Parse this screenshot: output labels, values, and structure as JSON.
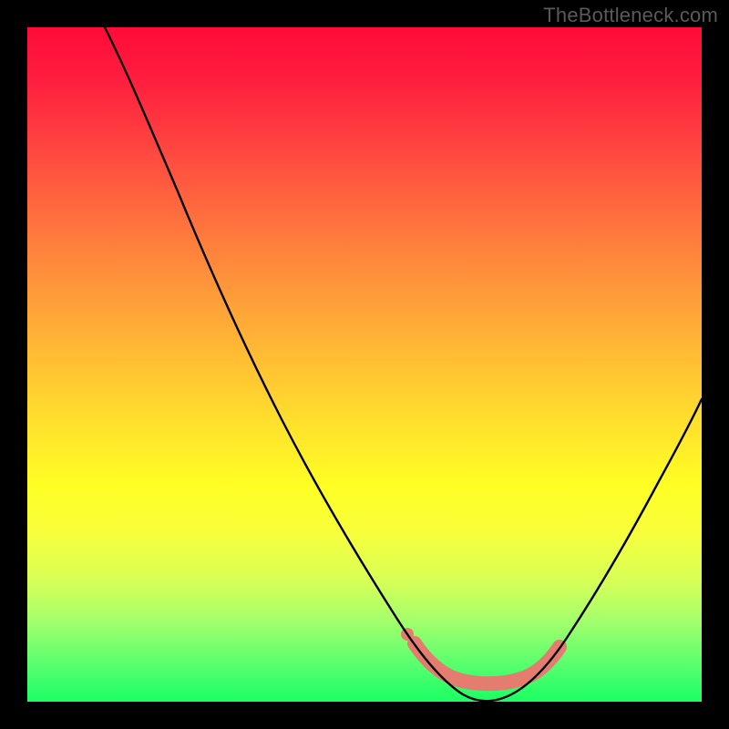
{
  "watermark": "TheBottleneck.com",
  "chart_data": {
    "type": "line",
    "title": "",
    "xlabel": "",
    "ylabel": "",
    "xlim": [
      0,
      100
    ],
    "ylim": [
      0,
      100
    ],
    "grid": false,
    "legend": false,
    "annotations": [],
    "series": [
      {
        "name": "bottleneck-curve",
        "x": [
          12,
          18,
          24,
          30,
          35,
          40,
          45,
          50,
          54,
          57,
          60,
          62,
          64,
          66,
          68,
          70,
          72,
          75,
          78,
          82,
          86,
          90,
          95,
          100
        ],
        "y": [
          100,
          93,
          85,
          76,
          68,
          60,
          51,
          42,
          33,
          25,
          17,
          11,
          7,
          3,
          1,
          0,
          1,
          3,
          7,
          13,
          20,
          28,
          36,
          45
        ]
      },
      {
        "name": "highlight-region",
        "x": [
          60,
          62,
          64,
          66,
          68,
          70,
          72,
          74,
          76
        ],
        "y": [
          8,
          6,
          4,
          3,
          3,
          3,
          4,
          6,
          8
        ]
      }
    ],
    "colors": {
      "curve": "#000000",
      "highlight": "#e47c70"
    }
  }
}
